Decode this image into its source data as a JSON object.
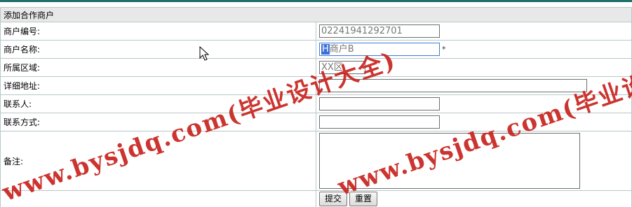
{
  "form": {
    "title": "添加合作商户",
    "fields": {
      "merchant_no": {
        "label": "商户编号:",
        "value": "02241941292701"
      },
      "merchant_name": {
        "label": "商户名称:",
        "value_selected": "H",
        "value_rest": "商户B",
        "required_mark": "*"
      },
      "region": {
        "label": "所属区域:",
        "value": "XX区"
      },
      "address": {
        "label": "详细地址:",
        "value": ""
      },
      "contact": {
        "label": "联系人:",
        "value": ""
      },
      "phone": {
        "label": "联系方式:",
        "value": ""
      },
      "remark": {
        "label": "备注:",
        "value": ""
      }
    },
    "buttons": {
      "submit": "提交",
      "reset": "重置"
    }
  },
  "watermark": {
    "text_left": "www.bysjdq.com(毕业设计大全)",
    "text_right": "www.bysjdq.com(毕业设计大",
    "color": "#c8231e"
  },
  "colors": {
    "header_bg": "#e8e8e8",
    "border": "#b9c7c9",
    "top_accent": "#1f6f6a",
    "focus_border": "#3a7bd5"
  }
}
